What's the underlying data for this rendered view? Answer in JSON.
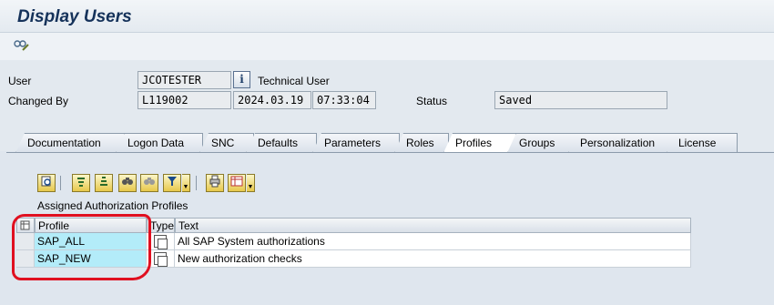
{
  "window": {
    "title": "Display Users"
  },
  "toolbar": {
    "other_user_icon": "glasses-pen-icon"
  },
  "header": {
    "user_label": "User",
    "user_value": "JCOTESTER",
    "info_icon_text": "i",
    "user_type": "Technical User",
    "changed_by_label": "Changed By",
    "changed_by_value": "L119002",
    "date_value": "2024.03.19",
    "time_value": "07:33:04",
    "status_label": "Status",
    "status_value": "Saved"
  },
  "tabs": [
    {
      "label": "Documentation"
    },
    {
      "label": "Logon Data"
    },
    {
      "label": "SNC"
    },
    {
      "label": "Defaults"
    },
    {
      "label": "Parameters"
    },
    {
      "label": "Roles"
    },
    {
      "label": "Profiles"
    },
    {
      "label": "Groups"
    },
    {
      "label": "Personalization"
    },
    {
      "label": "License"
    }
  ],
  "active_tab": "Profiles",
  "grid": {
    "title": "Assigned Authorization Profiles",
    "columns": [
      "Profile",
      "Type",
      "Text"
    ],
    "rows": [
      {
        "profile": "SAP_ALL",
        "text": "All SAP System authorizations"
      },
      {
        "profile": "SAP_NEW",
        "text": "New authorization checks"
      }
    ],
    "toolbar_icons": [
      "details-icon",
      "sort-ascending-icon",
      "sort-descending-icon",
      "find-icon",
      "find-next-icon",
      "filter-icon",
      "print-icon",
      "export-icon"
    ]
  },
  "colors": {
    "highlight_cell": "#b3ecf9",
    "annotation": "#e01020"
  }
}
